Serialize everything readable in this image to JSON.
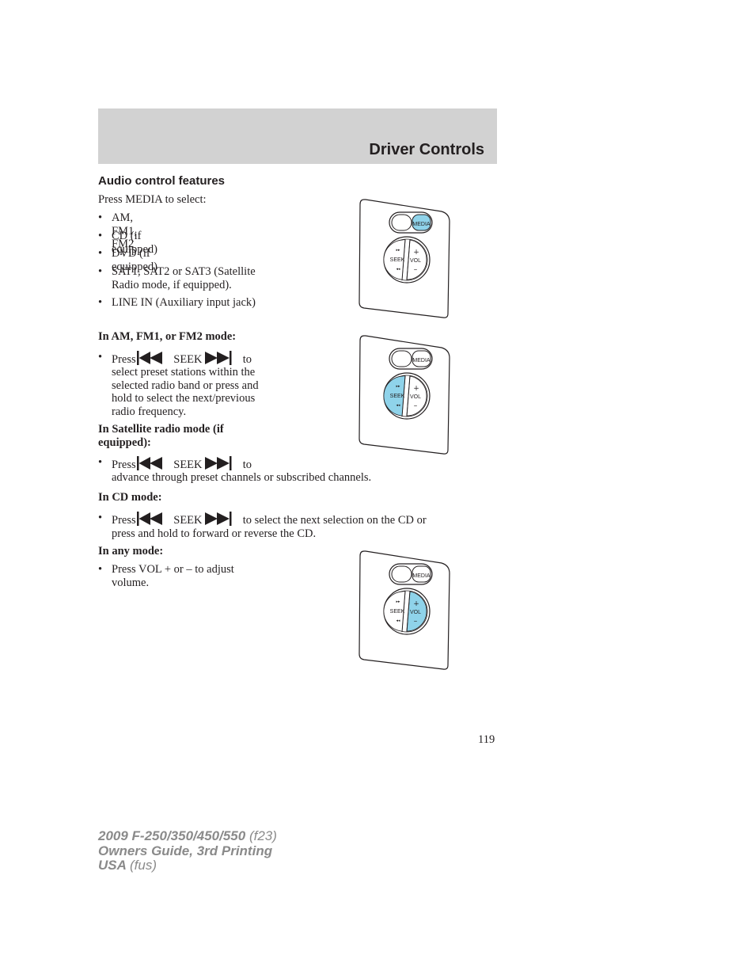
{
  "header": {
    "title": "Driver Controls"
  },
  "section": {
    "title": "Audio control features",
    "intro": "Press MEDIA to select:",
    "media_options": [
      "AM, FM1, FM2",
      "CD (if equipped)",
      "DVD (if equipped)",
      "SAT1, SAT2 or SAT3 (Satellite",
      "Radio mode, if equipped).",
      "LINE IN (Auxiliary input jack)"
    ]
  },
  "radio_mode": {
    "heading": "In AM, FM1, or FM2 mode:",
    "press": "Press",
    "seek": "SEEK",
    "to": "to",
    "lines": [
      "select preset stations within the",
      "selected radio band or press and",
      "hold to select the next/previous",
      "radio frequency."
    ]
  },
  "satellite_mode": {
    "heading_line1": "In Satellite radio mode (if",
    "heading_line2": "equipped):",
    "press": "Press",
    "seek": "SEEK",
    "to": "to",
    "line": "advance through preset channels or subscribed channels."
  },
  "cd_mode": {
    "heading": "In CD mode:",
    "press": "Press",
    "seek": "SEEK",
    "line1_rest": "to select the next selection on the CD or",
    "line2": "press and hold to forward or reverse the CD."
  },
  "any_mode": {
    "heading": "In any mode:",
    "line1": "Press VOL + or – to adjust",
    "line2": "volume."
  },
  "illustrations": {
    "media_label": "MEDIA",
    "seek_label": "SEEK",
    "vol_label": "VOL",
    "plus": "+",
    "minus": "–",
    "highlight_color": "#8fd3ea",
    "highlights": [
      "media",
      "seek",
      "vol"
    ]
  },
  "page_number": "119",
  "footer": {
    "line1_bold": "2009 F-250/350/450/550",
    "line1_light": "(f23)",
    "line2": "Owners Guide, 3rd Printing",
    "line3_bold": "USA",
    "line3_light": "(fus)"
  }
}
